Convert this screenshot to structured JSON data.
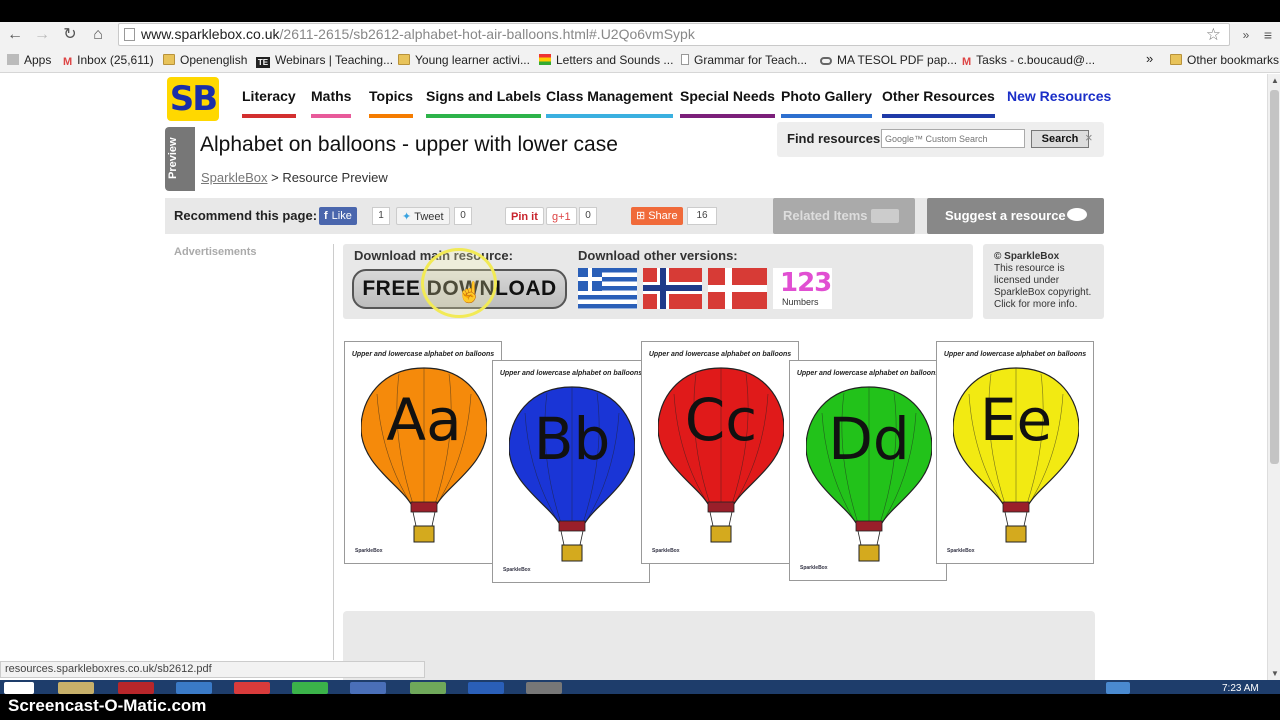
{
  "browser": {
    "url_host": "www.sparklebox.co.uk",
    "url_path": "/2611-2615/sb2612-alphabet-hot-air-balloons.html#.U2Qo6vmSypk",
    "bookmarks": [
      {
        "label": "Apps",
        "icon": "apps-icon"
      },
      {
        "label": "Inbox (25,611)",
        "icon": "gmail-icon"
      },
      {
        "label": "Openenglish",
        "icon": "folder-icon"
      },
      {
        "label": "Webinars | Teaching...",
        "icon": "te-icon"
      },
      {
        "label": "Young learner activi...",
        "icon": "folder-icon"
      },
      {
        "label": "Letters and Sounds ...",
        "icon": "flag-icon"
      },
      {
        "label": "Grammar for Teach...",
        "icon": "page-icon"
      },
      {
        "label": "MA TESOL PDF pap...",
        "icon": "link-icon"
      },
      {
        "label": "Tasks - c.boucaud@...",
        "icon": "gmail-icon"
      }
    ],
    "more_bookmarks": "»",
    "other_bookmarks": "Other bookmarks",
    "status_url": "resources.sparkleboxres.co.uk/sb2612.pdf"
  },
  "site": {
    "logo": "SB",
    "nav": [
      {
        "label": "Literacy",
        "color": "#d32f2f"
      },
      {
        "label": "Maths",
        "color": "#e85a9a"
      },
      {
        "label": "Topics",
        "color": "#f57c00"
      },
      {
        "label": "Signs and Labels",
        "color": "#2db34a"
      },
      {
        "label": "Class Management",
        "color": "#3ab0e0"
      },
      {
        "label": "Special Needs",
        "color": "#7b1f7a"
      },
      {
        "label": "Photo Gallery",
        "color": "#2d6fcf"
      },
      {
        "label": "Other Resources",
        "color": "#1f3aa8"
      },
      {
        "label": "New Resources",
        "color": "#ffffff"
      }
    ]
  },
  "page": {
    "preview_tab": "Preview",
    "title": "Alphabet on balloons - upper with lower case",
    "breadcrumb_link": "SparkleBox",
    "breadcrumb_sep": " > ",
    "breadcrumb_current": "Resource Preview",
    "find_label": "Find resources:",
    "search_placeholder": "Google™ Custom Search",
    "search_button": "Search",
    "close": "×"
  },
  "social": {
    "recommend_label": "Recommend this page:",
    "like_label": "Like",
    "like_count": "1",
    "tweet_label": "Tweet",
    "tweet_count": "0",
    "pinit_label": "Pin it",
    "gplus_label": "g+1",
    "gplus_count": "0",
    "share_label": "Share",
    "share_count": "16",
    "related_label": "Related Items",
    "suggest_label": "Suggest a resource"
  },
  "sidebar": {
    "ads_label": "Advertisements"
  },
  "download": {
    "main_label": "Download main resource:",
    "other_label": "Download other versions:",
    "button_label": "FREE DOWNLOAD",
    "numbers_glyph": "123",
    "numbers_label": "Numbers"
  },
  "license": {
    "heading": "© SparkleBox",
    "lines": [
      "This resource is",
      "licensed under",
      "SparkleBox copyright.",
      "Click for more info."
    ]
  },
  "previews": [
    {
      "caption": "Upper and lowercase alphabet on balloons",
      "letter": "Aa",
      "color": "#f58a0b"
    },
    {
      "caption": "Upper and lowercase alphabet on balloons",
      "letter": "Bb",
      "color": "#1a35d6"
    },
    {
      "caption": "Upper and lowercase alphabet on balloons",
      "letter": "Cc",
      "color": "#e01a1a"
    },
    {
      "caption": "Upper and lowercase alphabet on balloons",
      "letter": "Dd",
      "color": "#22c21a"
    },
    {
      "caption": "Upper and lowercase alphabet on balloons",
      "letter": "Ee",
      "color": "#f2ea12"
    }
  ],
  "taskbar": {
    "watermark": "Screencast-O-Matic.com",
    "clock": "7:23 AM"
  }
}
